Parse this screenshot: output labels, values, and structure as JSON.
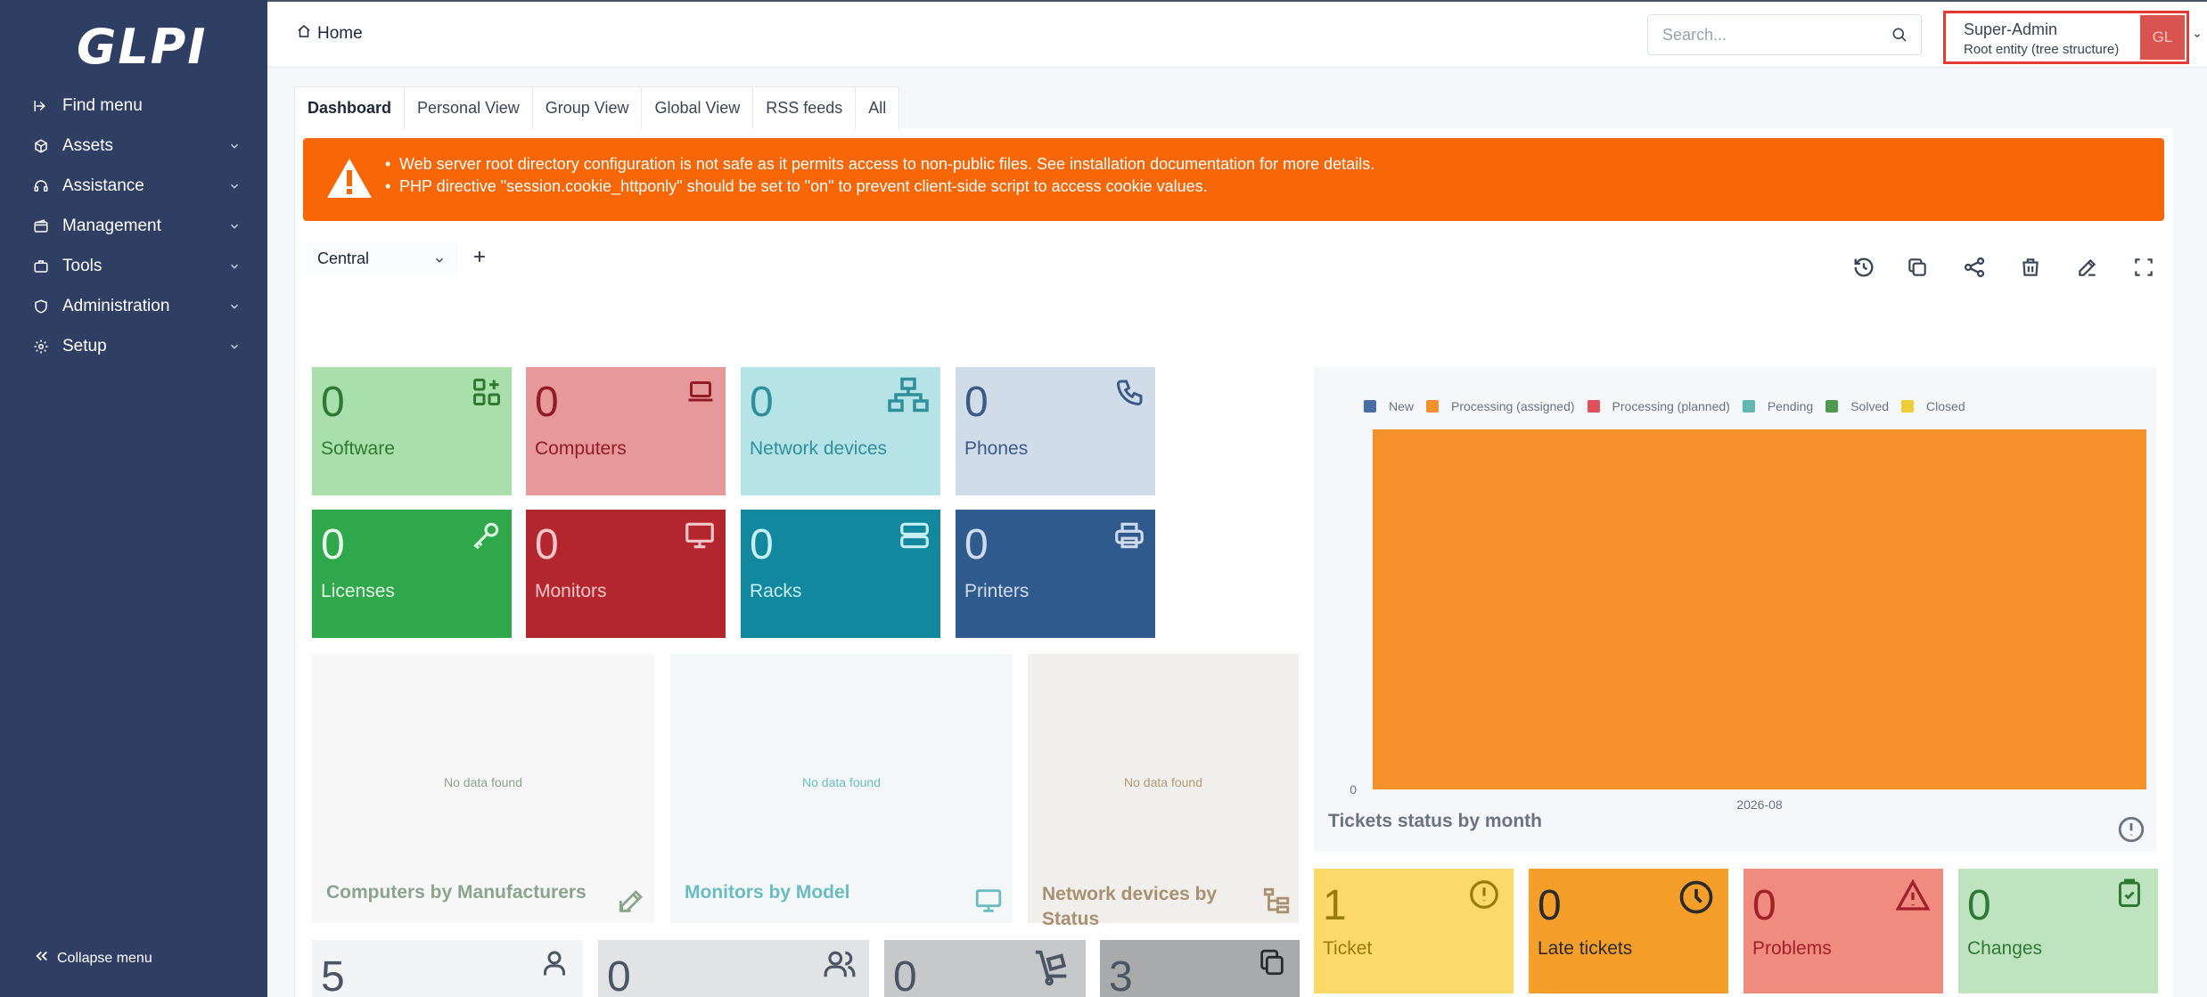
{
  "sidebar": {
    "logo": "GLPI",
    "items": [
      {
        "label": "Find menu",
        "icon": "arrow-right-icon"
      },
      {
        "label": "Assets",
        "icon": "cube-icon"
      },
      {
        "label": "Assistance",
        "icon": "headset-icon"
      },
      {
        "label": "Management",
        "icon": "wallet-icon"
      },
      {
        "label": "Tools",
        "icon": "briefcase-icon"
      },
      {
        "label": "Administration",
        "icon": "shield-icon"
      },
      {
        "label": "Setup",
        "icon": "gear-icon"
      }
    ],
    "collapse_label": "Collapse menu"
  },
  "header": {
    "breadcrumb": "Home",
    "search_placeholder": "Search...",
    "user_name": "Super-Admin",
    "user_entity": "Root entity (tree structure)",
    "avatar_initials": "GL"
  },
  "tabs": [
    "Dashboard",
    "Personal View",
    "Group View",
    "Global View",
    "RSS feeds",
    "All"
  ],
  "alert": {
    "color": "#f76707",
    "messages": [
      "Web server root directory configuration is not safe as it permits access to non-public files. See installation documentation for more details.",
      "PHP directive \"session.cookie_httponly\" should be set to \"on\" to prevent client-side script to access cookie values."
    ]
  },
  "dashboard_select": "Central",
  "cards": [
    {
      "value": "0",
      "label": "Software",
      "icon": "apps-plus-icon",
      "bg": "#a9dfab",
      "fg": "#2f7a33"
    },
    {
      "value": "0",
      "label": "Computers",
      "icon": "laptop-icon",
      "bg": "#e79898",
      "fg": "#8f1d24"
    },
    {
      "value": "0",
      "label": "Network devices",
      "icon": "network-icon",
      "bg": "#b6e3e6",
      "fg": "#2f8f9a"
    },
    {
      "value": "0",
      "label": "Phones",
      "icon": "phone-icon",
      "bg": "#d1dce9",
      "fg": "#3c5a88"
    },
    {
      "value": "0",
      "label": "Licenses",
      "icon": "key-icon",
      "bg": "#2ea84a",
      "fg": "#e6f6e9"
    },
    {
      "value": "0",
      "label": "Monitors",
      "icon": "monitor-icon",
      "bg": "#b4262d",
      "fg": "#f3c6c8"
    },
    {
      "value": "0",
      "label": "Racks",
      "icon": "server-icon",
      "bg": "#12889e",
      "fg": "#c6eef4"
    },
    {
      "value": "0",
      "label": "Printers",
      "icon": "printer-icon",
      "bg": "#2f5a8e",
      "fg": "#d0dcec"
    }
  ],
  "panels": [
    {
      "title": "Computers by Manufacturers",
      "nodata": "No data found",
      "icon": "edit-icon"
    },
    {
      "title": "Monitors by Model",
      "nodata": "No data found",
      "icon": "monitor-icon"
    },
    {
      "title": "Network devices by Status",
      "nodata": "No data found",
      "icon": "hierarchy-icon"
    }
  ],
  "people_cards": [
    {
      "value": "5",
      "icon": "user-icon"
    },
    {
      "value": "0",
      "icon": "users-icon"
    },
    {
      "value": "0",
      "icon": "dolly-icon"
    },
    {
      "value": "3",
      "icon": "copy-icon"
    }
  ],
  "ticket_cards": [
    {
      "value": "1",
      "label": "Ticket",
      "icon": "alert-circle-icon",
      "bg": "#fdd96a",
      "fg": "#9a7a0a"
    },
    {
      "value": "0",
      "label": "Late tickets",
      "icon": "clock-icon",
      "bg": "#f59f2a",
      "fg": "#2b2b2b"
    },
    {
      "value": "0",
      "label": "Problems",
      "icon": "warning-icon",
      "bg": "#ef8c7f",
      "fg": "#a1202a"
    },
    {
      "value": "0",
      "label": "Changes",
      "icon": "clipboard-check-icon",
      "bg": "#bfe3bf",
      "fg": "#2f7a33"
    }
  ],
  "chart_data": {
    "type": "bar",
    "title": "Tickets status by month",
    "categories": [
      "2026-08"
    ],
    "series": [
      {
        "name": "New",
        "color": "#4a6fa5",
        "values": [
          0
        ]
      },
      {
        "name": "Processing (assigned)",
        "color": "#f6902a",
        "values": [
          1
        ]
      },
      {
        "name": "Processing (planned)",
        "color": "#e0515a",
        "values": [
          0
        ]
      },
      {
        "name": "Pending",
        "color": "#60b8b0",
        "values": [
          0
        ]
      },
      {
        "name": "Solved",
        "color": "#4f9a4c",
        "values": [
          0
        ]
      },
      {
        "name": "Closed",
        "color": "#efcc3c",
        "values": [
          0
        ]
      }
    ],
    "y_tick_labels": [
      "0"
    ],
    "stacked": true,
    "legend": "top-left"
  }
}
